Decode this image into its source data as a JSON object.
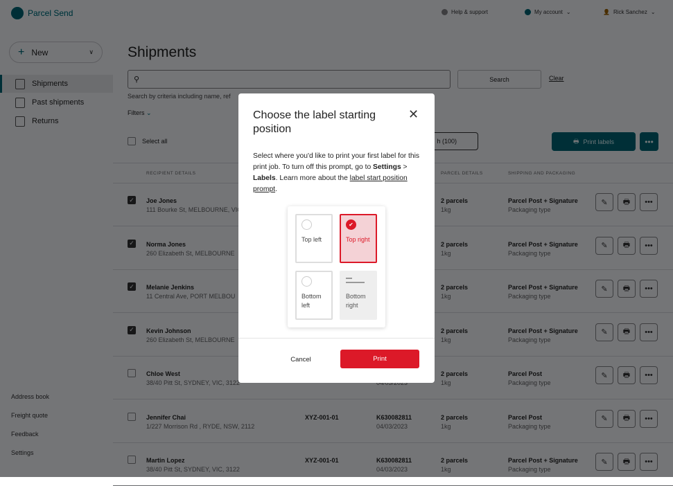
{
  "header": {
    "brand": "Parcel Send",
    "help": "Help & support",
    "account": "My account",
    "user": "Rick Sanchez"
  },
  "sidebar": {
    "new_label": "New",
    "items": [
      {
        "label": "Shipments"
      },
      {
        "label": "Past shipments"
      },
      {
        "label": "Returns"
      }
    ],
    "footer": [
      "Address book",
      "Freight quote",
      "Feedback",
      "Settings"
    ]
  },
  "main": {
    "title": "Shipments",
    "search_placeholder": "",
    "search_label": "Search",
    "clear_label": "Clear",
    "hint": "Search by criteria including name, ref",
    "filters": "Filters",
    "select_all": "Select all",
    "batch_label": "h (100)",
    "print_labels": "Print labels",
    "more": "•••",
    "columns": {
      "recipient": "RECIPIENT DETAILS",
      "parcel": "PARCEL DETAILS",
      "shipping": "SHIPPING AND PACKAGING"
    },
    "rows": [
      {
        "checked": true,
        "name": "Joe Jones",
        "address": "111 Bourke St, MELBOURNE, VIC",
        "ref": "",
        "tracking": "",
        "date": "",
        "parcels": "2 parcels",
        "weight": "1kg",
        "service": "Parcel Post + Signature",
        "packaging": "Packaging type"
      },
      {
        "checked": true,
        "name": "Norma Jones",
        "address": "260 Elizabeth St, MELBOURNE",
        "ref": "",
        "tracking": "",
        "date": "",
        "parcels": "2 parcels",
        "weight": "1kg",
        "service": "Parcel Post + Signature",
        "packaging": "Packaging type"
      },
      {
        "checked": true,
        "name": "Melanie Jenkins",
        "address": "11 Central Ave, PORT MELBOU",
        "ref": "",
        "tracking": "",
        "date": "",
        "parcels": "2 parcels",
        "weight": "1kg",
        "service": "Parcel Post + Signature",
        "packaging": "Packaging type"
      },
      {
        "checked": true,
        "name": "Kevin Johnson",
        "address": "260 Elizabeth St, MELBOURNE",
        "ref": "",
        "tracking": "",
        "date": "",
        "parcels": "2 parcels",
        "weight": "1kg",
        "service": "Parcel Post + Signature",
        "packaging": "Packaging type"
      },
      {
        "checked": false,
        "name": "Chloe West",
        "address": "38/40 Pitt St, SYDNEY, VIC, 3122",
        "ref": "",
        "tracking": "",
        "date": "04/03/2023",
        "parcels": "2 parcels",
        "weight": "1kg",
        "service": "Parcel Post",
        "packaging": "Packaging type"
      },
      {
        "checked": false,
        "name": "Jennifer Chai",
        "address": "1/227 Morrison Rd , RYDE, NSW, 2112",
        "ref": "XYZ-001-01",
        "tracking": "K630082811",
        "date": "04/03/2023",
        "parcels": "2 parcels",
        "weight": "1kg",
        "service": "Parcel Post",
        "packaging": "Packaging type"
      },
      {
        "checked": false,
        "name": "Martin Lopez",
        "address": "38/40 Pitt St, SYDNEY, VIC, 3122",
        "ref": "XYZ-001-01",
        "tracking": "K630082811",
        "date": "04/03/2023",
        "parcels": "2 parcels",
        "weight": "1kg",
        "service": "Parcel Post + Signature",
        "packaging": "Packaging type"
      }
    ]
  },
  "modal": {
    "title": "Choose the label starting position",
    "p1": "Select where you'd like to print your first label for this print job. To turn off this prompt, go to ",
    "settings": "Settings",
    "sep": " > ",
    "labels": "Labels",
    "p2": ". Learn more about the ",
    "link": "label start position prompt",
    "p3": ".",
    "positions": [
      {
        "label": "Top left",
        "state": "available"
      },
      {
        "label": "Top right",
        "state": "selected"
      },
      {
        "label": "Bottom left",
        "state": "available"
      },
      {
        "label": "Bottom right",
        "state": "used"
      }
    ],
    "cancel": "Cancel",
    "print": "Print"
  },
  "colors": {
    "brand": "#dc1928"
  }
}
